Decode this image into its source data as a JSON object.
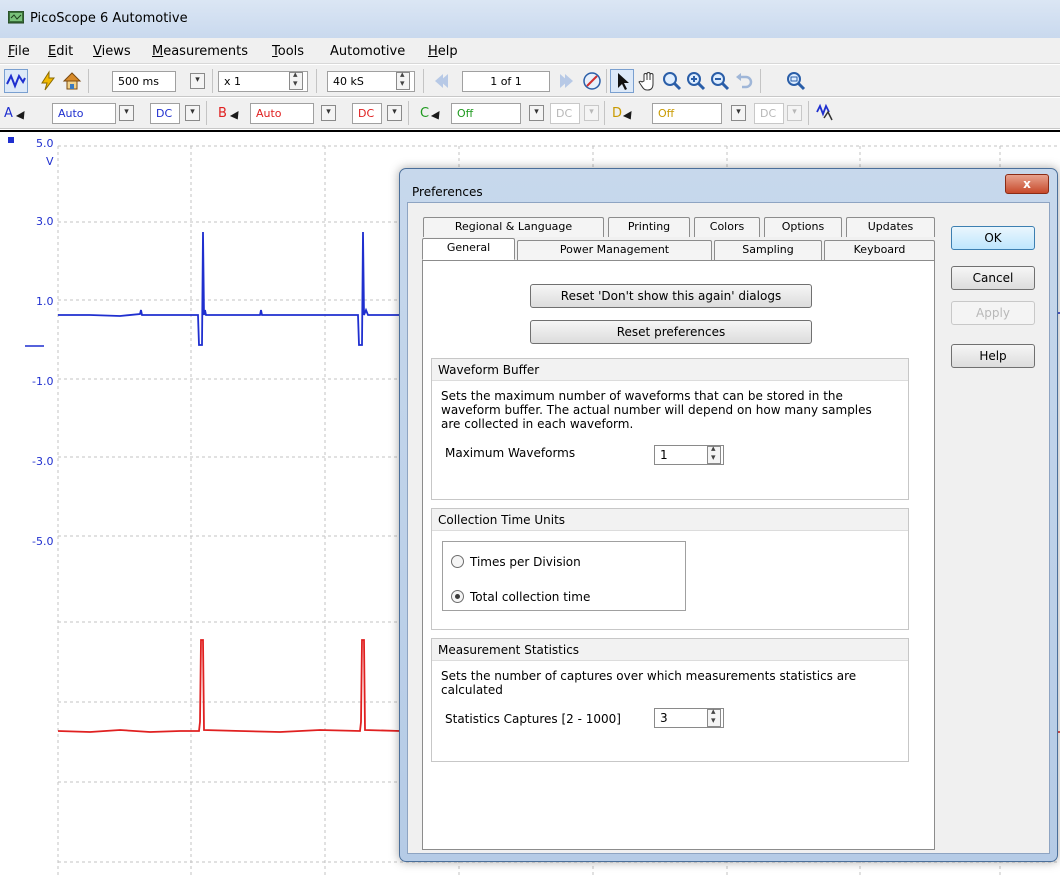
{
  "window": {
    "title": "PicoScope 6 Automotive"
  },
  "menu": {
    "items": [
      {
        "label": "File",
        "ul": "F",
        "rest": "ile"
      },
      {
        "label": "Edit",
        "ul": "E",
        "rest": "dit"
      },
      {
        "label": "Views",
        "ul": "V",
        "rest": "iews"
      },
      {
        "label": "Measurements",
        "ul": "M",
        "rest": "easurements"
      },
      {
        "label": "Tools",
        "ul": "T",
        "rest": "ools"
      },
      {
        "label": "Automotive",
        "ul": "",
        "rest": "Automotive"
      },
      {
        "label": "Help",
        "ul": "H",
        "rest": "elp"
      }
    ]
  },
  "toolbar": {
    "timebase": "500 ms",
    "zoom": "x 1",
    "samples": "40 kS",
    "buffer_page": "1 of 1"
  },
  "channels": {
    "a": {
      "name": "A",
      "range": "Auto",
      "coupling": "DC",
      "color": "#1f2fcf"
    },
    "b": {
      "name": "B",
      "range": "Auto",
      "coupling": "DC",
      "color": "#e02020"
    },
    "c": {
      "name": "C",
      "range": "Off",
      "coupling": "DC",
      "color": "#1f9a1f"
    },
    "d": {
      "name": "D",
      "range": "Off",
      "coupling": "DC",
      "color": "#c99a00"
    }
  },
  "scope": {
    "y_axis_labels": [
      "5.0",
      "V",
      "3.0",
      "1.0",
      "-1.0",
      "-3.0",
      "-5.0"
    ],
    "trace_a_color": "#1f2fcf",
    "trace_b_color": "#e02020"
  },
  "dialog": {
    "title": "Preferences",
    "close_label": "x",
    "tabs_row1": [
      "Regional & Language",
      "Printing",
      "Colors",
      "Options",
      "Updates"
    ],
    "tabs_row2": [
      "General",
      "Power Management",
      "Sampling",
      "Keyboard"
    ],
    "active_tab": "General",
    "buttons": {
      "ok": "OK",
      "cancel": "Cancel",
      "apply": "Apply",
      "help": "Help"
    },
    "reset_dialogs_label": "Reset 'Don't show this again' dialogs",
    "reset_prefs_label": "Reset preferences",
    "waveform_buffer": {
      "heading": "Waveform Buffer",
      "description_lines": [
        "Sets the maximum number of waveforms that can be stored in the",
        "waveform buffer. The actual number will depend on how many samples",
        "are collected in each waveform."
      ],
      "max_label": "Maximum Waveforms",
      "max_value": "1"
    },
    "collection_time": {
      "heading": "Collection Time Units",
      "options": [
        "Times per Division",
        "Total collection time"
      ],
      "selected": "Total collection time"
    },
    "measurement_stats": {
      "heading": "Measurement Statistics",
      "description_lines": [
        "Sets the number of captures over which measurements statistics are",
        "calculated"
      ],
      "captures_label": "Statistics Captures [2 - 1000]",
      "captures_value": "3"
    }
  }
}
